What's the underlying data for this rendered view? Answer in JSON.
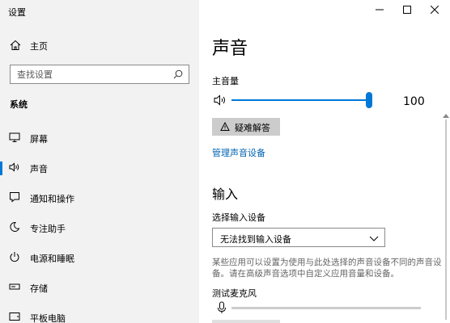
{
  "window": {
    "title": "设置",
    "controls": {
      "minimize": "minimize-icon",
      "maximize": "maximize-icon",
      "close": "close-icon"
    }
  },
  "sidebar": {
    "home_label": "主页",
    "search_placeholder": "查找设置",
    "section_label": "系统",
    "items": [
      {
        "label": "屏幕",
        "icon": "monitor-icon",
        "active": false
      },
      {
        "label": "声音",
        "icon": "speaker-icon",
        "active": true
      },
      {
        "label": "通知和操作",
        "icon": "notification-icon",
        "active": false
      },
      {
        "label": "专注助手",
        "icon": "moon-icon",
        "active": false
      },
      {
        "label": "电源和睡眠",
        "icon": "power-icon",
        "active": false
      },
      {
        "label": "存储",
        "icon": "storage-icon",
        "active": false
      },
      {
        "label": "平板电脑",
        "icon": "tablet-icon",
        "active": false
      }
    ]
  },
  "main": {
    "title": "声音",
    "master_volume": {
      "label": "主音量",
      "value": "100",
      "level": 1.0
    },
    "troubleshoot_label": "疑难解答",
    "manage_devices_link": "管理声音设备",
    "input": {
      "heading": "输入",
      "select_label": "选择输入设备",
      "selected_device": "无法找到输入设备",
      "note": "某些应用可以设置为使用与此处选择的声音设备不同的声音设备。请在高级声音选项中自定义应用音量和设备。",
      "test_mic_label": "测试麦克风"
    }
  },
  "colors": {
    "accent": "#0078d7",
    "link": "#0063b1",
    "sidebar_bg": "#f2f2f2"
  }
}
